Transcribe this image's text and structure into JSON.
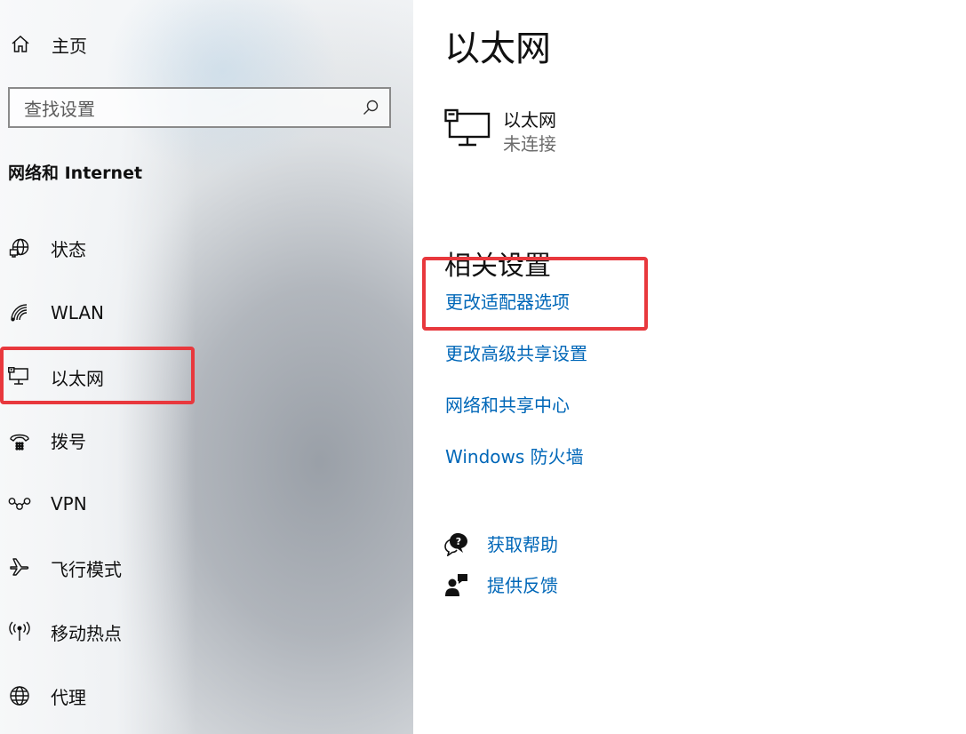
{
  "sidebar": {
    "home_label": "主页",
    "search_placeholder": "查找设置",
    "section_title": "网络和 Internet",
    "items": [
      {
        "label": "状态",
        "icon": "status-globe-icon"
      },
      {
        "label": "WLAN",
        "icon": "wifi-icon"
      },
      {
        "label": "以太网",
        "icon": "ethernet-icon"
      },
      {
        "label": "拨号",
        "icon": "dialup-icon"
      },
      {
        "label": "VPN",
        "icon": "vpn-icon"
      },
      {
        "label": "飞行模式",
        "icon": "airplane-icon"
      },
      {
        "label": "移动热点",
        "icon": "hotspot-icon"
      },
      {
        "label": "代理",
        "icon": "proxy-globe-icon"
      }
    ]
  },
  "main": {
    "title": "以太网",
    "connection": {
      "name": "以太网",
      "status": "未连接"
    },
    "related_title": "相关设置",
    "links": [
      "更改适配器选项",
      "更改高级共享设置",
      "网络和共享中心",
      "Windows 防火墙"
    ],
    "help": {
      "get_help": "获取帮助",
      "feedback": "提供反馈"
    }
  },
  "colors": {
    "link": "#0067b8",
    "highlight_box": "#e8383d"
  }
}
